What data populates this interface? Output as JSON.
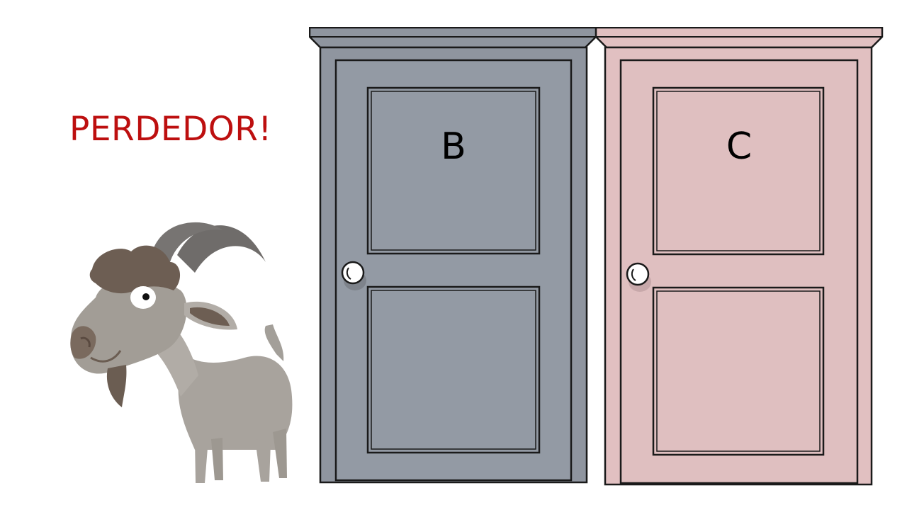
{
  "message": {
    "text": "PERDEDOR!",
    "color": "#bd0f0f"
  },
  "doors": [
    {
      "label": "B",
      "color": "#939aa4",
      "trim_color": "#8f959f"
    },
    {
      "label": "C",
      "color": "#dfbfc0",
      "trim_color": "#e1c0c1"
    }
  ],
  "character": {
    "icon": "goat-icon"
  }
}
